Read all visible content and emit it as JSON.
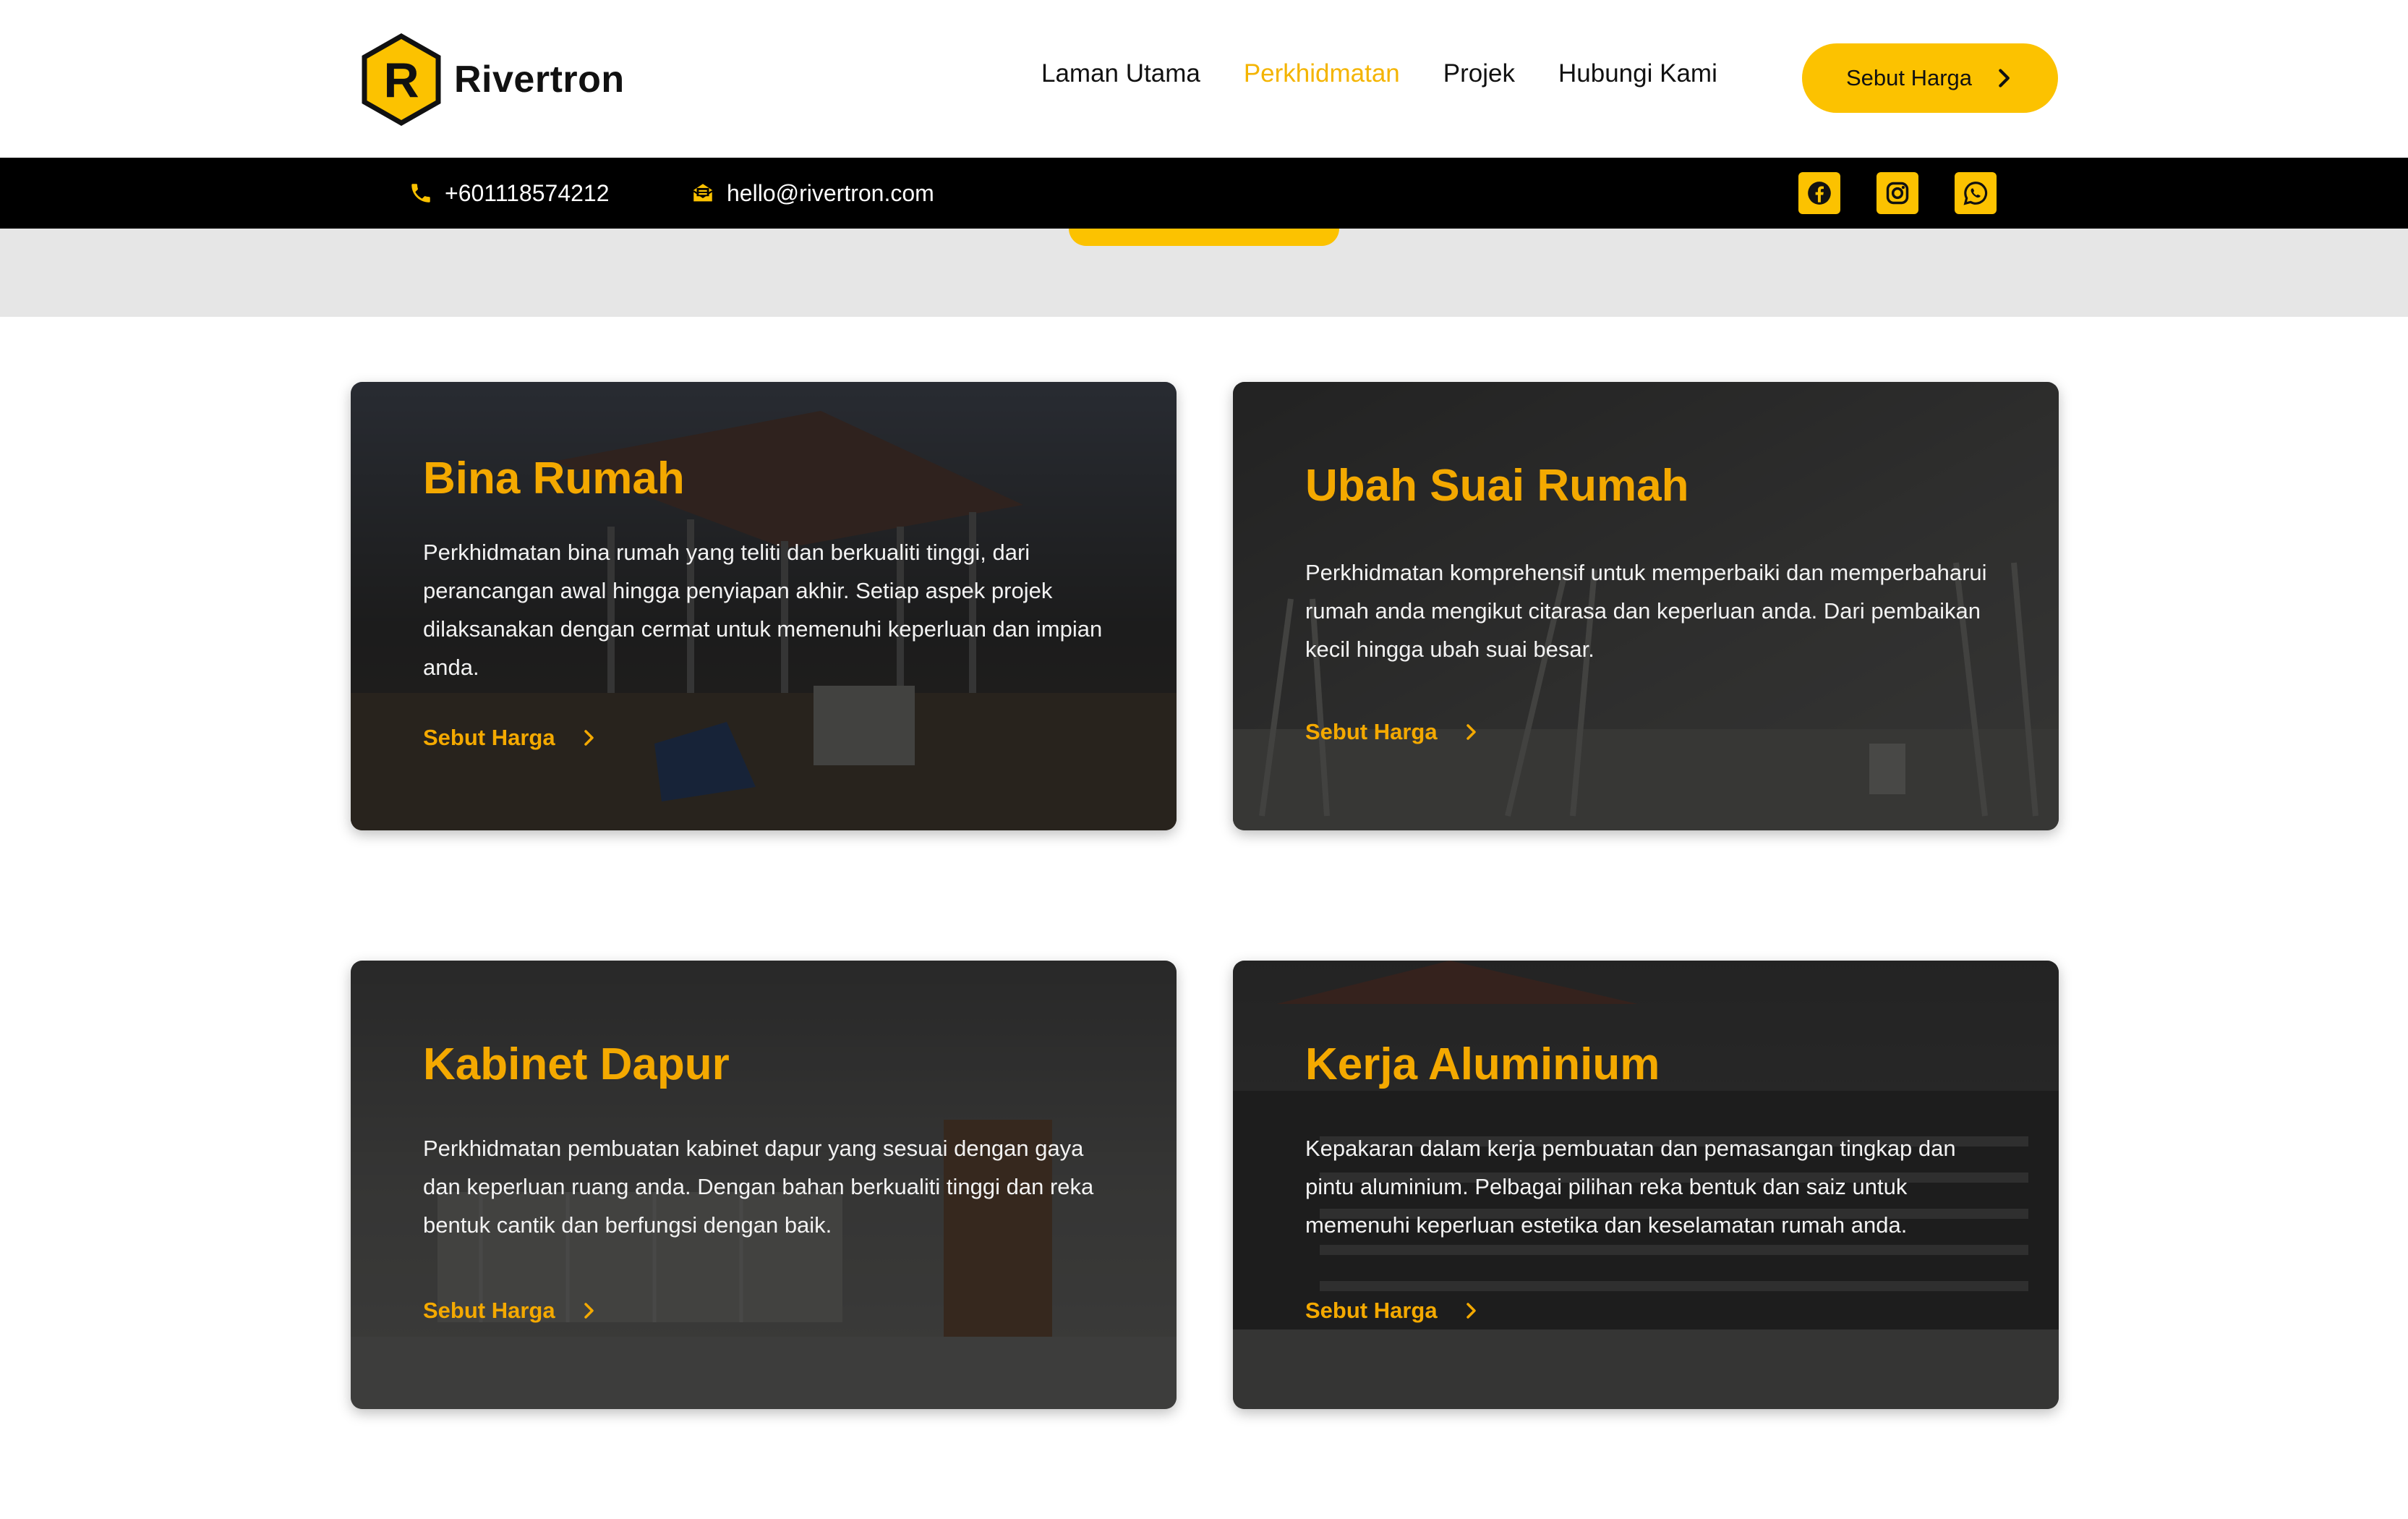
{
  "brand": {
    "initial": "R",
    "name": "Rivertron",
    "accent": "#fcc200"
  },
  "nav": {
    "items": [
      {
        "label": "Laman Utama",
        "active": false
      },
      {
        "label": "Perkhidmatan",
        "active": true
      },
      {
        "label": "Projek",
        "active": false
      },
      {
        "label": "Hubungi Kami",
        "active": false
      }
    ],
    "cta_label": "Sebut Harga"
  },
  "topbar": {
    "phone": "+601118574212",
    "email": "hello@rivertron.com",
    "socials": [
      "facebook-icon",
      "instagram-icon",
      "whatsapp-icon"
    ]
  },
  "services": [
    {
      "title": "Bina Rumah",
      "description": "Perkhidmatan bina rumah yang teliti dan berkualiti tinggi, dari perancangan awal hingga penyiapan akhir. Setiap aspek projek dilaksanakan dengan cermat untuk memenuhi keperluan dan impian anda.",
      "link_label": "Sebut Harga"
    },
    {
      "title": "Ubah Suai Rumah",
      "description": "Perkhidmatan komprehensif untuk memperbaiki dan memperbaharui rumah anda mengikut citarasa dan keperluan anda. Dari pembaikan kecil hingga ubah suai besar.",
      "link_label": "Sebut Harga"
    },
    {
      "title": "Kabinet Dapur",
      "description": "Perkhidmatan pembuatan kabinet dapur yang sesuai dengan gaya dan keperluan ruang anda. Dengan bahan berkualiti tinggi dan reka bentuk cantik dan berfungsi dengan baik.",
      "link_label": "Sebut Harga"
    },
    {
      "title": "Kerja Aluminium",
      "description": "Kepakaran dalam kerja pembuatan dan pemasangan tingkap dan pintu aluminium. Pelbagai pilihan reka bentuk dan saiz untuk memenuhi keperluan estetika dan keselamatan rumah anda.",
      "link_label": "Sebut Harga"
    }
  ]
}
